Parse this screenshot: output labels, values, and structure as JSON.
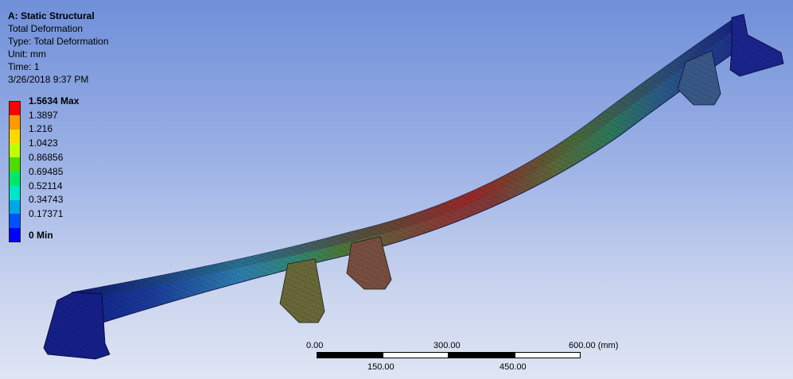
{
  "info": {
    "title": "A: Static Structural",
    "result": "Total Deformation",
    "type": "Type: Total Deformation",
    "unit": "Unit: mm",
    "time": "Time: 1",
    "date": "3/26/2018 9:37 PM"
  },
  "legend": [
    {
      "label": "1.5634 Max",
      "color": "#ff0000",
      "bold": true
    },
    {
      "label": "1.3897",
      "color": "#ff9a00",
      "bold": false
    },
    {
      "label": "1.216",
      "color": "#ffd800",
      "bold": false
    },
    {
      "label": "1.0423",
      "color": "#c0ff00",
      "bold": false
    },
    {
      "label": "0.86856",
      "color": "#4ddc00",
      "bold": false
    },
    {
      "label": "0.69485",
      "color": "#00e86a",
      "bold": false
    },
    {
      "label": "0.52114",
      "color": "#00e6c8",
      "bold": false
    },
    {
      "label": "0.34743",
      "color": "#00a6e6",
      "bold": false
    },
    {
      "label": "0.17371",
      "color": "#0052ff",
      "bold": false
    },
    {
      "label": "0 Min",
      "color": "#0000ff",
      "bold": true
    }
  ],
  "scale": {
    "top_labels": [
      "0.00",
      "300.00",
      "600.00 (mm)"
    ],
    "bottom_labels": [
      "150.00",
      "450.00"
    ]
  }
}
